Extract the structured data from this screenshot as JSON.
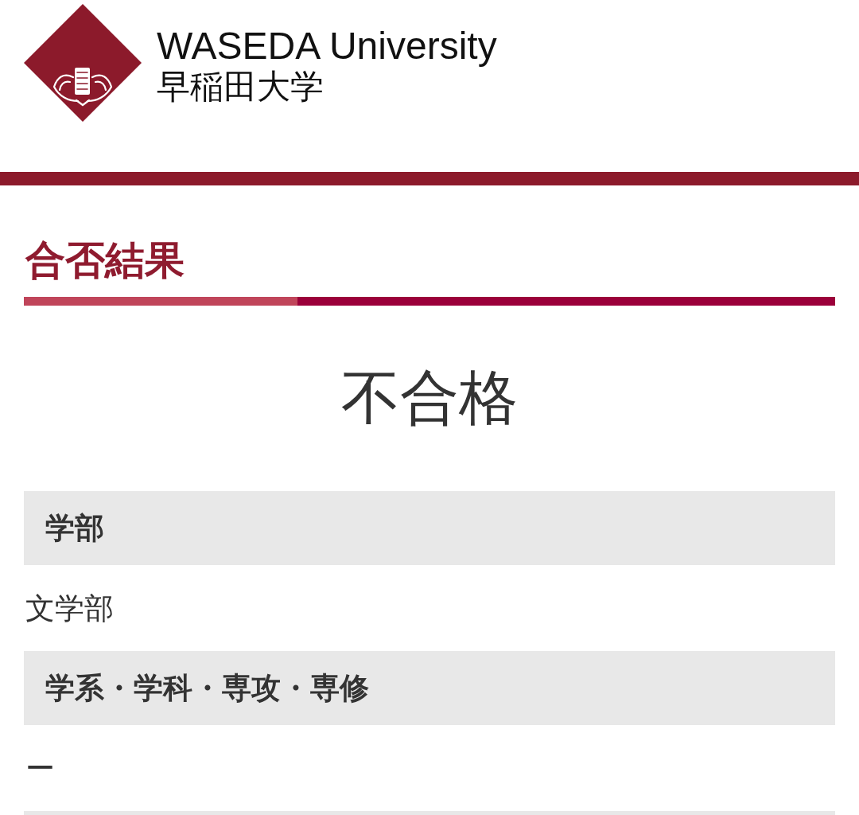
{
  "header": {
    "logo_text": "WASEDA University",
    "logo_text_ja": "早稲田大学"
  },
  "page_title": "合否結果",
  "result": "不合格",
  "fields": [
    {
      "kind": "field",
      "label": "学部",
      "value": "文学部"
    },
    {
      "kind": "field",
      "label": "学系・学科・専攻・専修",
      "value": "ー"
    },
    {
      "kind": "cut_off"
    }
  ]
}
